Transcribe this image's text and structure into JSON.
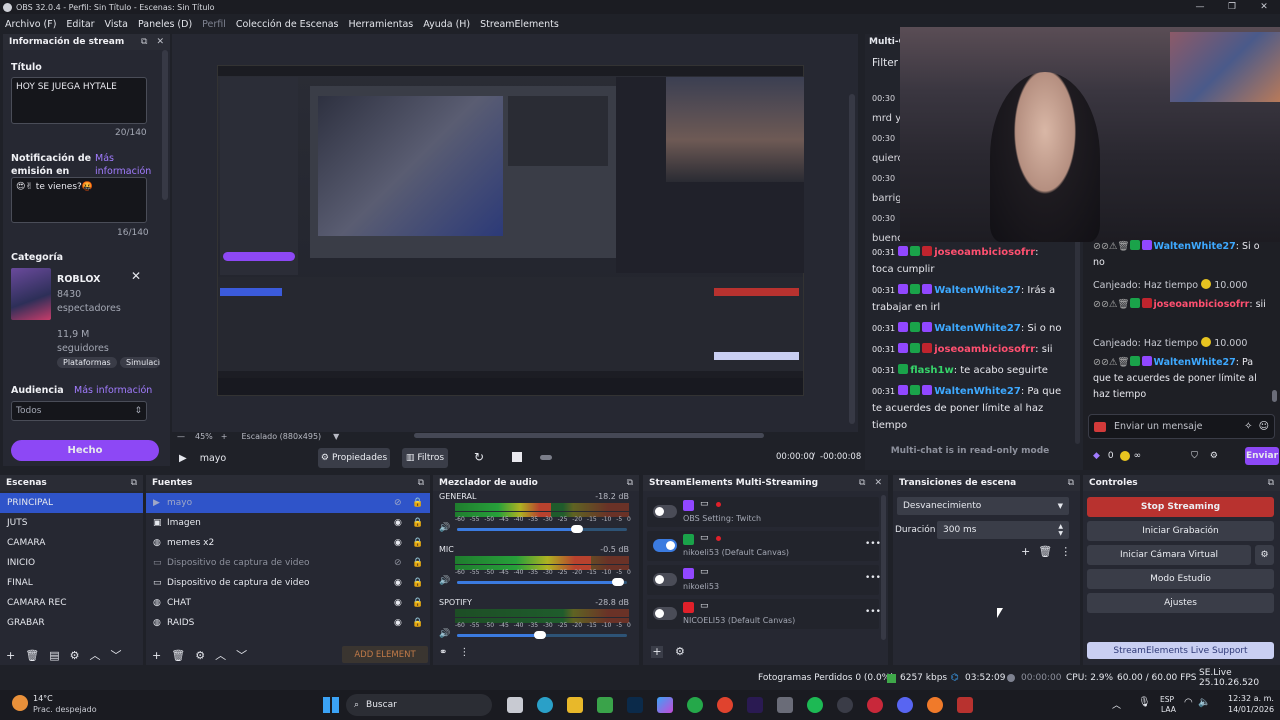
{
  "window": {
    "title": "OBS 32.0.4 - Perfil: Sin Título - Escenas: Sin Título"
  },
  "menu": [
    "Archivo (F)",
    "Editar",
    "Vista",
    "Paneles (D)",
    "Perfil",
    "Colección de Escenas",
    "Herramientas",
    "Ayuda (H)",
    "StreamElements"
  ],
  "stream_info": {
    "title": "Información de stream",
    "title_label": "Título",
    "title_value": "HOY SE JUEGA HYTALE",
    "title_count": "20/140",
    "notif_label": "Notificación de emisión en directo",
    "notif_link": "Más información",
    "notif_value": "😍✌ te vienes?🤬",
    "notif_count": "16/140",
    "category_label": "Categoría",
    "cat_name": "ROBLOX",
    "cat_viewers": "8430",
    "cat_viewers_label": "espectadores",
    "cat_followers": "11,9 M",
    "cat_followers_label": "seguidores",
    "cat_tags": [
      "Plataformas",
      "Simulaci"
    ],
    "audience_label": "Audiencia",
    "audience_link": "Más información",
    "audience_value": "Todos",
    "done_button": "Hecho"
  },
  "preview": {
    "zoom": "45%",
    "scale": "Escalado (880x495)",
    "source_name": "mayo",
    "properties": "Propiedades",
    "filters": "Filtros",
    "time": "00:00:00",
    "time_sep": "/",
    "time_total": "-00:00:08"
  },
  "multichat": {
    "header": "Multi-C",
    "filter": "Filter",
    "readonly": "Multi-chat is in read-only mode",
    "lines": [
      {
        "time": "00:31",
        "user": "joseoambiciosofrr",
        "msg": "toca cumplir"
      },
      {
        "time": "00:31",
        "user": "WaltenWhite27",
        "msg": "Irás a trabajar en irl"
      },
      {
        "time": "00:31",
        "user": "WaltenWhite27",
        "msg": "Si o no"
      },
      {
        "time": "00:31",
        "user": "joseoambiciosofrr",
        "msg": "sii"
      },
      {
        "time": "00:31",
        "user": "flash1w",
        "msg": "te acabo seguirte"
      },
      {
        "time": "00:31",
        "user": "WaltenWhite27",
        "msg": "Pa que te acuerdes de poner límite al haz tiempo"
      }
    ],
    "partial_lines": [
      "00:30",
      "mrd y",
      "00:30",
      "quiero",
      "00:30",
      "barrig",
      "00:30",
      "buenc"
    ]
  },
  "twitch_chat": {
    "lines": [
      {
        "user": "WaltenWhite27",
        "msg": "Si o no"
      },
      {
        "redeem": "Canjeado: Haz tiempo",
        "cost": "10.000"
      },
      {
        "user": "joseoambiciosofrr",
        "msg": "sii"
      },
      {
        "redeem": "Canjeado: Haz tiempo",
        "cost": "10.000"
      },
      {
        "user": "WaltenWhite27",
        "msg": "Pa que te acuerdes de poner límite al haz tiempo"
      }
    ],
    "input_placeholder": "Enviar un mensaje",
    "points": "0",
    "infinity": "∞",
    "send": "Enviar"
  },
  "scenes": {
    "title": "Escenas",
    "items": [
      "PRINCIPAL",
      "JUTS",
      "CAMARA",
      "INICIO",
      "FINAL",
      "CAMARA REC",
      "GRABAR"
    ]
  },
  "sources": {
    "title": "Fuentes",
    "items": [
      "mayo",
      "Imagen",
      "memes x2",
      "Dispositivo de captura de video",
      "Dispositivo de captura de video",
      "CHAT",
      "RAIDS"
    ],
    "add_element": "ADD ELEMENT"
  },
  "mixer": {
    "title": "Mezclador de audio",
    "channels": [
      {
        "name": "GENERAL",
        "db": "-18.2 dB",
        "level": 0.55,
        "volume": 0.72
      },
      {
        "name": "MIC",
        "db": "-0.5 dB",
        "level": 0.78,
        "volume": 0.96
      },
      {
        "name": "SPOTIFY",
        "db": "-28.8 dB",
        "level": 0.0,
        "volume": 0.5
      }
    ],
    "ticks": [
      "-60",
      "-55",
      "-50",
      "-45",
      "-40",
      "-35",
      "-30",
      "-25",
      "-20",
      "-15",
      "-10",
      "-5",
      "0"
    ]
  },
  "multistream": {
    "title": "StreamElements Multi-Streaming",
    "items": [
      {
        "label": "OBS Setting: Twitch",
        "on": false,
        "platform": "twitch"
      },
      {
        "label": "nikoeli53 (Default Canvas)",
        "on": true,
        "platform": "kick"
      },
      {
        "label": "nikoeli53",
        "on": false,
        "platform": "twitch"
      },
      {
        "label": "NICOELI53 (Default Canvas)",
        "on": false,
        "platform": "youtube"
      }
    ]
  },
  "transitions": {
    "title": "Transiciones de escena",
    "type": "Desvanecimiento",
    "duration_label": "Duración",
    "duration": "300 ms"
  },
  "controls": {
    "title": "Controles",
    "stop": "Stop Streaming",
    "record": "Iniciar Grabación",
    "vcam": "Iniciar Cámara Virtual",
    "studio": "Modo Estudio",
    "settings": "Ajustes",
    "support": "StreamElements Live Support"
  },
  "statusbar": {
    "dropped": "Fotogramas Perdidos 0 (0.0%)",
    "kbps": "6257 kbps",
    "live": "03:52:09",
    "rec": "00:00:00",
    "cpu": "CPU: 2.9%",
    "fps": "60.00 / 60.00 FPS",
    "se": "SE.Live 25.10.26.520"
  },
  "taskbar": {
    "temp": "14°C",
    "weather": "Prac. despejado",
    "search": "Buscar",
    "lang1": "ESP",
    "lang2": "LAA",
    "time": "12:32 a. m.",
    "date": "14/01/2026"
  },
  "colors": {
    "accent": "#9147ff",
    "stop": "#b8322f",
    "support": "#c9cff2"
  }
}
